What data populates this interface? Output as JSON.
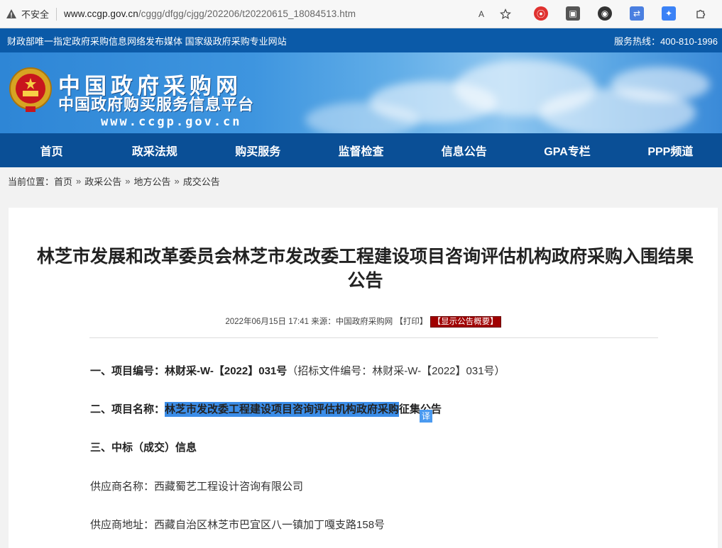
{
  "browser": {
    "security_label": "不安全",
    "url_host": "www.ccgp.gov.cn",
    "url_path": "/cggg/dfgg/cjgg/202206/t20220615_18084513.htm",
    "read_aloud_icon": "A",
    "t1": "⦿",
    "t2": "▣",
    "t3": "◉",
    "t4": "⇄",
    "t5": "✦"
  },
  "top_strip": {
    "left": "财政部唯一指定政府采购信息网络发布媒体 国家级政府采购专业网站",
    "right": "服务热线：400-810-1996"
  },
  "banner": {
    "title": "中国政府采购网",
    "subtitle": "中国政府购买服务信息平台",
    "url": "www.ccgp.gov.cn"
  },
  "nav": [
    "首页",
    "政采法规",
    "购买服务",
    "监督检查",
    "信息公告",
    "GPA专栏",
    "PPP频道"
  ],
  "breadcrumb": {
    "prefix": "当前位置：",
    "items": [
      "首页",
      "政采公告",
      "地方公告",
      "成交公告"
    ],
    "sep": "»"
  },
  "article": {
    "title": "林芝市发展和改革委员会林芝市发改委工程建设项目咨询评估机构政府采购入围结果公告",
    "meta_date": "2022年06月15日 17:41",
    "meta_source": "来源：中国政府采购网",
    "meta_print": "【打印】",
    "meta_badge": "【显示公告概要】",
    "s1_label": "一、项目编号：",
    "s1_value": "林财采-W-【2022】031号",
    "s1_note": "（招标文件编号：林财采-W-【2022】031号）",
    "s2_label": "二、项目名称：",
    "s2_highlight": "林芝市发改委工程建设项目咨询评估机构政府采购",
    "s2_rest": "征集公告",
    "translate_badge": "译",
    "s3_label": "三、中标（成交）信息",
    "supplier_name_label": "供应商名称：",
    "supplier_name": "西藏蜀艺工程设计咨询有限公司",
    "supplier_addr_label": "供应商地址：",
    "supplier_addr": "西藏自治区林芝市巴宜区八一镇加丁嘎支路158号"
  }
}
